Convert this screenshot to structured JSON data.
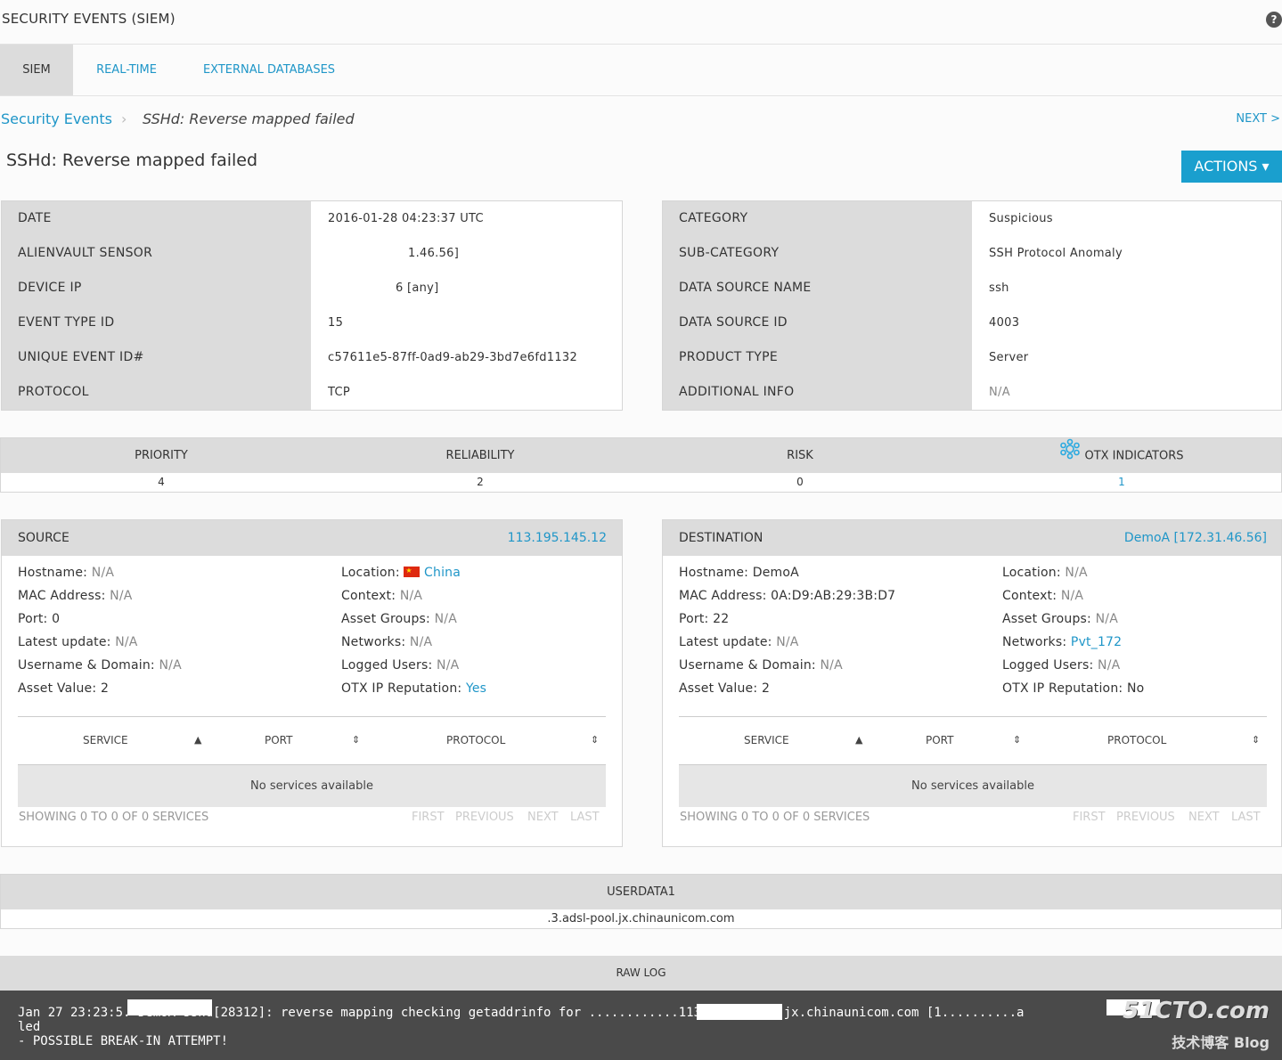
{
  "header": {
    "title": "SECURITY EVENTS (SIEM)",
    "help": "?"
  },
  "tabs": [
    {
      "label": "SIEM",
      "active": true
    },
    {
      "label": "REAL-TIME",
      "active": false
    },
    {
      "label": "EXTERNAL DATABASES",
      "active": false
    }
  ],
  "breadcrumb": {
    "parent": "Security Events",
    "separator": "›",
    "current": "SSHd: Reverse mapped failed"
  },
  "next_label": "NEXT >",
  "event_title": "SSHd: Reverse mapped failed",
  "actions_label": "ACTIONS ▾",
  "details_left": [
    {
      "label": "DATE",
      "value": "2016-01-28 04:23:37 UTC"
    },
    {
      "label": "ALIENVAULT SENSOR",
      "value": "1.46.56]"
    },
    {
      "label": "DEVICE IP",
      "value": "6 [any]"
    },
    {
      "label": "EVENT TYPE ID",
      "value": "15"
    },
    {
      "label": "UNIQUE EVENT ID#",
      "value": "c57611e5-87ff-0ad9-ab29-3bd7e6fd1132"
    },
    {
      "label": "PROTOCOL",
      "value": "TCP"
    }
  ],
  "details_right": [
    {
      "label": "CATEGORY",
      "value": "Suspicious"
    },
    {
      "label": "SUB-CATEGORY",
      "value": "SSH Protocol Anomaly"
    },
    {
      "label": "DATA SOURCE NAME",
      "value": "ssh"
    },
    {
      "label": "DATA SOURCE ID",
      "value": "4003"
    },
    {
      "label": "PRODUCT TYPE",
      "value": "Server"
    },
    {
      "label": "ADDITIONAL INFO",
      "value": "N/A"
    }
  ],
  "metrics": [
    {
      "label": "PRIORITY",
      "value": "4"
    },
    {
      "label": "RELIABILITY",
      "value": "2"
    },
    {
      "label": "RISK",
      "value": "0"
    },
    {
      "label": "OTX INDICATORS",
      "value": "1"
    }
  ],
  "source": {
    "title": "SOURCE",
    "ip": "113.195.145.12",
    "left": [
      {
        "k": "Hostname:",
        "v": "N/A"
      },
      {
        "k": "MAC Address:",
        "v": "N/A"
      },
      {
        "k": "Port:",
        "v": "0"
      },
      {
        "k": "Latest update:",
        "v": "N/A"
      },
      {
        "k": "Username & Domain:",
        "v": "N/A"
      },
      {
        "k": "Asset Value:",
        "v": "2"
      }
    ],
    "right": [
      {
        "k": "Location:",
        "v": "China"
      },
      {
        "k": "Context:",
        "v": "N/A"
      },
      {
        "k": "Asset Groups:",
        "v": "N/A"
      },
      {
        "k": "Networks:",
        "v": "N/A"
      },
      {
        "k": "Logged Users:",
        "v": "N/A"
      },
      {
        "k": "OTX IP Reputation:",
        "v": "Yes"
      }
    ]
  },
  "destination": {
    "title": "DESTINATION",
    "ip": "DemoA [172.31.46.56]",
    "left": [
      {
        "k": "Hostname:",
        "v": "DemoA"
      },
      {
        "k": "MAC Address:",
        "v": "0A:D9:AB:29:3B:D7"
      },
      {
        "k": "Port:",
        "v": "22"
      },
      {
        "k": "Latest update:",
        "v": "N/A"
      },
      {
        "k": "Username & Domain:",
        "v": "N/A"
      },
      {
        "k": "Asset Value:",
        "v": "2"
      }
    ],
    "right": [
      {
        "k": "Location:",
        "v": "N/A"
      },
      {
        "k": "Context:",
        "v": "N/A"
      },
      {
        "k": "Asset Groups:",
        "v": "N/A"
      },
      {
        "k": "Networks:",
        "v": "Pvt_172"
      },
      {
        "k": "Logged Users:",
        "v": "N/A"
      },
      {
        "k": "OTX IP Reputation:",
        "v": "No"
      }
    ]
  },
  "services_table": {
    "columns": [
      "SERVICE",
      "PORT",
      "PROTOCOL"
    ],
    "empty": "No services available",
    "showing": "SHOWING 0 TO 0 OF 0 SERVICES",
    "pager": [
      "FIRST",
      "PREVIOUS",
      "NEXT",
      "LAST"
    ]
  },
  "userdata": {
    "title": "USERDATA1",
    "value": ".3.adsl-pool.jx.chinaunicom.com"
  },
  "rawlog": {
    "title": "RAW LOG",
    "text": "Jan 27 23:23:5. DemoA sshd[28312]: reverse mapping checking getaddrinfo for ............113.adsl-pool.jx.chinaunicom.com [1..........a\nled\n- POSSIBLE BREAK-IN ATTEMPT!"
  },
  "watermark": {
    "main": "51CTO.com",
    "sub": "技术博客 Blog"
  },
  "colors": {
    "accent": "#1f96c8",
    "button": "#1a9fce",
    "header_gray": "#dcdcdc"
  }
}
